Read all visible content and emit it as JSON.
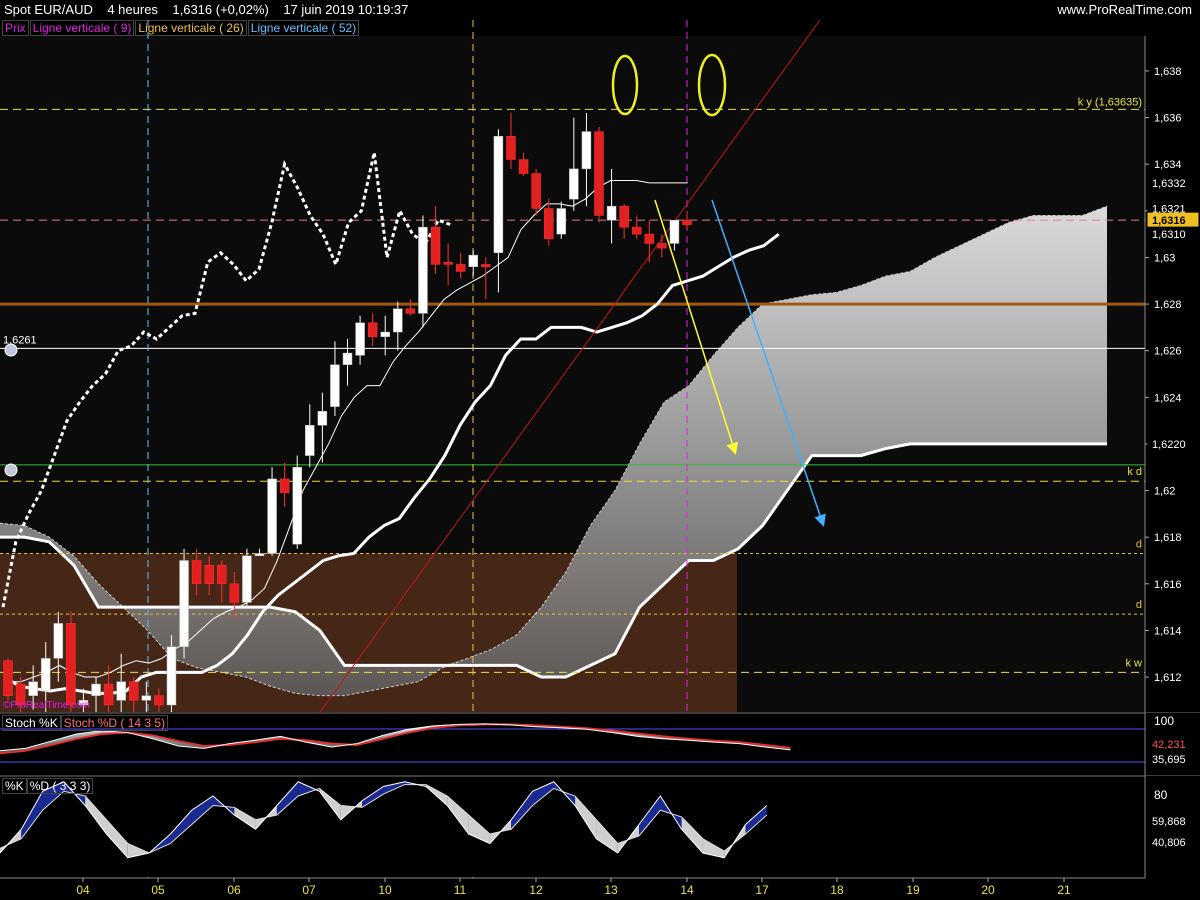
{
  "header": {
    "title": "Spot EUR/AUD",
    "timeframe": "4 heures",
    "quote": "1,6316 (+0,02%)",
    "datetime": "17 juin 2019 10:19:37",
    "brand": "www.ProRealTime.com"
  },
  "legend": [
    {
      "label": "Prix",
      "color": "#e020e0"
    },
    {
      "label": "Ligne verticale ( 9)",
      "color": "#e020e0"
    },
    {
      "label": "Ligne verticale ( 26)",
      "color": "#f0c040"
    },
    {
      "label": "Ligne verticale ( 52)",
      "color": "#60c0ff"
    }
  ],
  "watermark": "©ProRealTime.com",
  "price_labels": {
    "left_level": "1,6261",
    "kv": "k y (1,63635)",
    "kd": "k d",
    "d1": "d",
    "d2": "d",
    "kw": "k w"
  },
  "chart_data": [
    {
      "type": "candlestick",
      "title": "Spot EUR/AUD",
      "ylim": [
        1.6105,
        1.6395
      ],
      "y_ticks": [
        "1,638",
        "1,636",
        "1,634",
        "1,632",
        "1,63",
        "1,628",
        "1,626",
        "1,624",
        "1,622",
        "1,62",
        "1,618",
        "1,616",
        "1,614",
        "1,612"
      ],
      "y_tick_values": [
        1.638,
        1.636,
        1.634,
        1.632,
        1.63,
        1.628,
        1.626,
        1.624,
        1.622,
        1.62,
        1.618,
        1.616,
        1.614,
        1.612
      ],
      "x_ticks": [
        "04",
        "05",
        "06",
        "07",
        "10",
        "11",
        "12",
        "13",
        "14",
        "17",
        "18",
        "19",
        "20",
        "21"
      ],
      "highlighted_values": [
        {
          "label": "1,6332",
          "value": 1.6332
        },
        {
          "label": "1,6321",
          "value": 1.6321
        },
        {
          "label": "1,6316",
          "value": 1.6316,
          "current": true
        },
        {
          "label": "1,6310",
          "value": 1.631
        },
        {
          "label": "1,6220",
          "value": 1.622
        }
      ],
      "horizontal_levels": [
        {
          "value": 1.63635,
          "style": "dashed",
          "color": "#e8e040",
          "label": "k y (1,63635)"
        },
        {
          "value": 1.6316,
          "style": "dashed",
          "color": "#e08080"
        },
        {
          "value": 1.628,
          "style": "solid",
          "color": "#a05a10"
        },
        {
          "value": 1.6261,
          "style": "solid",
          "color": "#ffffff",
          "label": "1,6261"
        },
        {
          "value": 1.6211,
          "style": "solid",
          "color": "#30c030"
        },
        {
          "value": 1.6204,
          "style": "dashed",
          "color": "#e8e040",
          "label": "k d"
        },
        {
          "value": 1.6173,
          "style": "dotted",
          "color": "#e8c040",
          "label": "d"
        },
        {
          "value": 1.6147,
          "style": "dotted",
          "color": "#e8c040",
          "label": "d"
        },
        {
          "value": 1.6122,
          "style": "dashed",
          "color": "#e8e040",
          "label": "k w"
        }
      ],
      "candles": [
        [
          1.6127,
          1.6128,
          1.611,
          1.6112
        ],
        [
          1.6117,
          1.612,
          1.6105,
          1.6108
        ],
        [
          1.6112,
          1.6125,
          1.6106,
          1.6118
        ],
        [
          1.6114,
          1.6135,
          1.6105,
          1.6128
        ],
        [
          1.6128,
          1.6148,
          1.6118,
          1.6143
        ],
        [
          1.6143,
          1.6148,
          1.6105,
          1.6108
        ],
        [
          1.6108,
          1.6115,
          1.6105,
          1.611
        ],
        [
          1.6112,
          1.612,
          1.6105,
          1.6117
        ],
        [
          1.6117,
          1.6125,
          1.6105,
          1.6108
        ],
        [
          1.611,
          1.613,
          1.6105,
          1.6118
        ],
        [
          1.6118,
          1.612,
          1.6105,
          1.611
        ],
        [
          1.611,
          1.6118,
          1.6105,
          1.6112
        ],
        [
          1.6112,
          1.6115,
          1.6105,
          1.6108
        ],
        [
          1.6108,
          1.6138,
          1.6105,
          1.6133
        ],
        [
          1.6133,
          1.6175,
          1.6128,
          1.617
        ],
        [
          1.617,
          1.6175,
          1.6155,
          1.616
        ],
        [
          1.6168,
          1.6172,
          1.6155,
          1.616
        ],
        [
          1.6168,
          1.617,
          1.6152,
          1.616
        ],
        [
          1.616,
          1.6165,
          1.6145,
          1.6152
        ],
        [
          1.6152,
          1.6175,
          1.615,
          1.6172
        ],
        [
          1.6172,
          1.6175,
          1.6172,
          1.6173
        ],
        [
          1.6173,
          1.621,
          1.6172,
          1.6205
        ],
        [
          1.6205,
          1.6212,
          1.6193,
          1.6199
        ],
        [
          1.6177,
          1.6215,
          1.6175,
          1.621
        ],
        [
          1.6215,
          1.6237,
          1.621,
          1.6228
        ],
        [
          1.6228,
          1.6242,
          1.6212,
          1.6234
        ],
        [
          1.6236,
          1.6264,
          1.6232,
          1.6254
        ],
        [
          1.6254,
          1.6265,
          1.6245,
          1.6259
        ],
        [
          1.6258,
          1.6275,
          1.6254,
          1.6272
        ],
        [
          1.6272,
          1.6276,
          1.6262,
          1.6266
        ],
        [
          1.6266,
          1.6275,
          1.6258,
          1.6268
        ],
        [
          1.6268,
          1.6281,
          1.626,
          1.6278
        ],
        [
          1.6278,
          1.6282,
          1.6275,
          1.6276
        ],
        [
          1.6276,
          1.6318,
          1.627,
          1.6313
        ],
        [
          1.6313,
          1.6322,
          1.6293,
          1.6297
        ],
        [
          1.6298,
          1.6306,
          1.6288,
          1.6297
        ],
        [
          1.6297,
          1.6302,
          1.6291,
          1.6294
        ],
        [
          1.6296,
          1.6303,
          1.6292,
          1.6301
        ],
        [
          1.6297,
          1.63,
          1.6282,
          1.6296
        ],
        [
          1.6302,
          1.6355,
          1.6285,
          1.6352
        ],
        [
          1.6352,
          1.6362,
          1.6338,
          1.6342
        ],
        [
          1.6342,
          1.6345,
          1.6335,
          1.6336
        ],
        [
          1.6336,
          1.6338,
          1.6318,
          1.6321
        ],
        [
          1.6321,
          1.6325,
          1.6305,
          1.6308
        ],
        [
          1.631,
          1.6324,
          1.6308,
          1.6321
        ],
        [
          1.6325,
          1.636,
          1.632,
          1.6338
        ],
        [
          1.6338,
          1.6362,
          1.6322,
          1.6354
        ],
        [
          1.6354,
          1.6356,
          1.6315,
          1.6318
        ],
        [
          1.6316,
          1.6338,
          1.6306,
          1.6322
        ],
        [
          1.6322,
          1.6323,
          1.6308,
          1.6313
        ],
        [
          1.6313,
          1.6318,
          1.6308,
          1.631
        ],
        [
          1.631,
          1.6316,
          1.6298,
          1.6306
        ],
        [
          1.6306,
          1.631,
          1.63,
          1.6304
        ],
        [
          1.6306,
          1.6316,
          1.6303,
          1.6316
        ],
        [
          1.6316,
          1.632,
          1.6312,
          1.6314
        ]
      ],
      "series": [
        {
          "name": "Tenkan",
          "values": [
            1.6118,
            1.6118,
            1.612,
            1.6122,
            1.6125,
            1.6122,
            1.612,
            1.612,
            1.6122,
            1.6125,
            1.6127,
            1.6126,
            1.6128,
            1.6132,
            1.6135,
            1.614,
            1.6145,
            1.6148,
            1.615,
            1.6153,
            1.6158,
            1.617,
            1.6185,
            1.62,
            1.621,
            1.622,
            1.6232,
            1.624,
            1.6245,
            1.6245,
            1.6255,
            1.6262,
            1.6268,
            1.6275,
            1.6282,
            1.6286,
            1.6289,
            1.6292,
            1.6296,
            1.63,
            1.6312,
            1.6318,
            1.6323,
            1.6323,
            1.6322,
            1.6325,
            1.633,
            1.6333,
            1.6333,
            1.6333,
            1.6332,
            1.6332,
            1.6332,
            1.6332
          ]
        },
        {
          "name": "Kijun",
          "values": [
            1.612,
            1.6116,
            1.6115,
            1.6114,
            1.6115,
            1.6114,
            1.6113,
            1.6113,
            1.6114,
            1.612,
            1.6122,
            1.6122,
            1.6122,
            1.6122,
            1.6125,
            1.613,
            1.6138,
            1.6148,
            1.6155,
            1.616,
            1.6165,
            1.617,
            1.6172,
            1.6173,
            1.618,
            1.6185,
            1.6188,
            1.6197,
            1.6205,
            1.6215,
            1.6228,
            1.6238,
            1.6245,
            1.6258,
            1.6265,
            1.6265,
            1.627,
            1.627,
            1.627,
            1.6268,
            1.627,
            1.6272,
            1.6275,
            1.628,
            1.6288,
            1.629,
            1.6292,
            1.6296,
            1.63,
            1.6303,
            1.6305,
            1.631
          ]
        },
        {
          "name": "Chikou",
          "values": [
            1.615,
            1.6178,
            1.619,
            1.62,
            1.6215,
            1.623,
            1.6238,
            1.6245,
            1.625,
            1.626,
            1.6262,
            1.6268,
            1.6265,
            1.627,
            1.6275,
            1.6276,
            1.6298,
            1.6302,
            1.6297,
            1.629,
            1.6295,
            1.6315,
            1.634,
            1.633,
            1.6318,
            1.631,
            1.6297,
            1.6315,
            1.632,
            1.6345,
            1.63,
            1.632,
            1.631,
            1.6306,
            1.6316,
            1.6314
          ]
        },
        {
          "name": "SSA",
          "values": [
            1.6186,
            1.6185,
            1.618,
            1.6172,
            1.616,
            1.615,
            1.614,
            1.6128,
            1.6124,
            1.6122,
            1.612,
            1.6116,
            1.6113,
            1.6112,
            1.6112,
            1.6114,
            1.6116,
            1.6118,
            1.6124,
            1.6128,
            1.6132,
            1.6138,
            1.615,
            1.6165,
            1.6185,
            1.62,
            1.622,
            1.6238,
            1.6245,
            1.6258,
            1.627,
            1.628,
            1.6282,
            1.6284,
            1.6285,
            1.6288,
            1.6292,
            1.6294,
            1.63,
            1.6305,
            1.631,
            1.6315,
            1.6318,
            1.6318,
            1.6318,
            1.6322
          ]
        },
        {
          "name": "SSB",
          "values": [
            1.618,
            1.618,
            1.6178,
            1.6168,
            1.615,
            1.615,
            1.615,
            1.615,
            1.615,
            1.615,
            1.615,
            1.615,
            1.6148,
            1.614,
            1.6125,
            1.6125,
            1.6125,
            1.6125,
            1.6125,
            1.6125,
            1.6125,
            1.6125,
            1.612,
            1.612,
            1.6125,
            1.613,
            1.615,
            1.616,
            1.617,
            1.617,
            1.6175,
            1.6185,
            1.62,
            1.6215,
            1.6215,
            1.6215,
            1.6218,
            1.622,
            1.622,
            1.622,
            1.622,
            1.622,
            1.622,
            1.622,
            1.622,
            1.622
          ]
        }
      ]
    },
    {
      "type": "area",
      "title": "Stoch %K Stoch %D ( 14 3 5)",
      "y_ticks": [
        "100"
      ],
      "highlighted_values": [
        {
          "label": "42,231",
          "value": 42.231
        },
        {
          "label": "35,695",
          "value": 35.695
        }
      ],
      "series": [
        {
          "name": "Stoch %K",
          "values": [
            40,
            45,
            60,
            75,
            82,
            78,
            65,
            50,
            45,
            55,
            62,
            70,
            58,
            48,
            55,
            72,
            85,
            92,
            95,
            96,
            94,
            90,
            88,
            85,
            78,
            70,
            65,
            62,
            58,
            55,
            48,
            42
          ]
        },
        {
          "name": "Stoch %D",
          "values": [
            35,
            40,
            52,
            65,
            75,
            78,
            72,
            60,
            50,
            52,
            58,
            65,
            62,
            55,
            52,
            65,
            78,
            88,
            93,
            95,
            95,
            93,
            90,
            87,
            82,
            76,
            70,
            65,
            61,
            58,
            52,
            46
          ]
        }
      ]
    },
    {
      "type": "area",
      "title": "%K %D ( 3 3 3)",
      "y_ticks": [
        "80"
      ],
      "highlighted_values": [
        {
          "label": "59,868",
          "value": 59.868
        },
        {
          "label": "40,806",
          "value": 40.806
        }
      ],
      "series": [
        {
          "name": "%K",
          "values": [
            20,
            45,
            85,
            95,
            70,
            40,
            15,
            20,
            40,
            65,
            80,
            60,
            45,
            70,
            95,
            85,
            55,
            75,
            90,
            95,
            90,
            70,
            40,
            30,
            55,
            85,
            95,
            70,
            35,
            20,
            50,
            80,
            45,
            20,
            15,
            50,
            70
          ]
        },
        {
          "name": "%D",
          "values": [
            25,
            35,
            65,
            85,
            80,
            55,
            30,
            20,
            30,
            50,
            70,
            68,
            55,
            60,
            80,
            88,
            70,
            68,
            82,
            92,
            92,
            80,
            60,
            40,
            45,
            70,
            88,
            80,
            55,
            30,
            38,
            65,
            58,
            35,
            22,
            40,
            60
          ]
        }
      ]
    }
  ]
}
